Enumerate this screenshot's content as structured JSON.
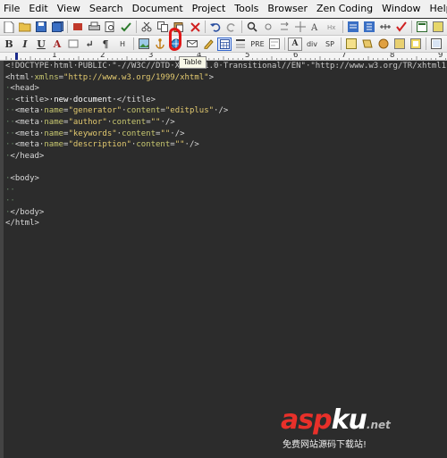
{
  "menu": {
    "items": [
      "File",
      "Edit",
      "View",
      "Search",
      "Document",
      "Project",
      "Tools",
      "Browser",
      "Zen Coding",
      "Window",
      "Help"
    ]
  },
  "toolbar_format": {
    "bold": "B",
    "italic": "I",
    "underline": "U",
    "anchor": "A",
    "line_break": "↵",
    "paragraph": "¶",
    "heading": "H",
    "list": "PRE",
    "div": "div",
    "span": "SP"
  },
  "tooltip": {
    "text": "Table"
  },
  "ruler": {
    "numbers": [
      "1",
      "2",
      "3",
      "4",
      "5",
      "6",
      "7",
      "8",
      "9"
    ]
  },
  "editor": {
    "lines": [
      {
        "parts": [
          {
            "c": "t-dt",
            "t": "<!DOCTYPE·html·PUBLIC·\"-//W3C//DTD·XHTML·1.0·Transitional//EN\"·\"http://www.w3.org/TR/xhtml1"
          }
        ]
      },
      {
        "parts": [
          {
            "c": "t-tag",
            "t": "<html·"
          },
          {
            "c": "t-attr",
            "t": "xmlns"
          },
          {
            "c": "t-tag",
            "t": "="
          },
          {
            "c": "t-str",
            "t": "\"http://www.w3.org/1999/xhtml\""
          },
          {
            "c": "t-tag",
            "t": ">"
          }
        ]
      },
      {
        "parts": [
          {
            "c": "t-dot",
            "t": "·"
          },
          {
            "c": "t-tag",
            "t": "<head>"
          }
        ]
      },
      {
        "parts": [
          {
            "c": "t-dot",
            "t": "··"
          },
          {
            "c": "t-tag",
            "t": "<title>"
          },
          {
            "c": "t-text",
            "t": "·new·document·"
          },
          {
            "c": "t-tag",
            "t": "</title>"
          }
        ]
      },
      {
        "parts": [
          {
            "c": "t-dot",
            "t": "··"
          },
          {
            "c": "t-tag",
            "t": "<meta·"
          },
          {
            "c": "t-attr",
            "t": "name"
          },
          {
            "c": "t-tag",
            "t": "="
          },
          {
            "c": "t-str",
            "t": "\"generator\""
          },
          {
            "c": "t-tag",
            "t": "·"
          },
          {
            "c": "t-attr",
            "t": "content"
          },
          {
            "c": "t-tag",
            "t": "="
          },
          {
            "c": "t-str",
            "t": "\"editplus\""
          },
          {
            "c": "t-tag",
            "t": "·/>"
          }
        ]
      },
      {
        "parts": [
          {
            "c": "t-dot",
            "t": "··"
          },
          {
            "c": "t-tag",
            "t": "<meta·"
          },
          {
            "c": "t-attr",
            "t": "name"
          },
          {
            "c": "t-tag",
            "t": "="
          },
          {
            "c": "t-str",
            "t": "\"author\""
          },
          {
            "c": "t-tag",
            "t": "·"
          },
          {
            "c": "t-attr",
            "t": "content"
          },
          {
            "c": "t-tag",
            "t": "="
          },
          {
            "c": "t-str",
            "t": "\"\""
          },
          {
            "c": "t-tag",
            "t": "·/>"
          }
        ]
      },
      {
        "parts": [
          {
            "c": "t-dot",
            "t": "··"
          },
          {
            "c": "t-tag",
            "t": "<meta·"
          },
          {
            "c": "t-attr",
            "t": "name"
          },
          {
            "c": "t-tag",
            "t": "="
          },
          {
            "c": "t-str",
            "t": "\"keywords\""
          },
          {
            "c": "t-tag",
            "t": "·"
          },
          {
            "c": "t-attr",
            "t": "content"
          },
          {
            "c": "t-tag",
            "t": "="
          },
          {
            "c": "t-str",
            "t": "\"\""
          },
          {
            "c": "t-tag",
            "t": "·/>"
          }
        ]
      },
      {
        "parts": [
          {
            "c": "t-dot",
            "t": "··"
          },
          {
            "c": "t-tag",
            "t": "<meta·"
          },
          {
            "c": "t-attr",
            "t": "name"
          },
          {
            "c": "t-tag",
            "t": "="
          },
          {
            "c": "t-str",
            "t": "\"description\""
          },
          {
            "c": "t-tag",
            "t": "·"
          },
          {
            "c": "t-attr",
            "t": "content"
          },
          {
            "c": "t-tag",
            "t": "="
          },
          {
            "c": "t-str",
            "t": "\"\""
          },
          {
            "c": "t-tag",
            "t": "·/>"
          }
        ]
      },
      {
        "parts": [
          {
            "c": "t-dot",
            "t": "·"
          },
          {
            "c": "t-tag",
            "t": "</head>"
          }
        ]
      },
      {
        "parts": [
          {
            "c": "t-dot",
            "t": ""
          }
        ]
      },
      {
        "parts": [
          {
            "c": "t-dot",
            "t": "·"
          },
          {
            "c": "t-tag",
            "t": "<body>"
          }
        ]
      },
      {
        "parts": [
          {
            "c": "t-dot",
            "t": "··"
          }
        ]
      },
      {
        "parts": [
          {
            "c": "t-dot",
            "t": "··"
          }
        ]
      },
      {
        "parts": [
          {
            "c": "t-dot",
            "t": "·"
          },
          {
            "c": "t-tag",
            "t": "</body>"
          }
        ]
      },
      {
        "parts": [
          {
            "c": "t-tag",
            "t": "</html>"
          }
        ]
      }
    ]
  },
  "watermark": {
    "logo_main": "asp",
    "logo_ku": "ku",
    "logo_net": ".net",
    "subtitle": "免费网站源码下载站!"
  }
}
